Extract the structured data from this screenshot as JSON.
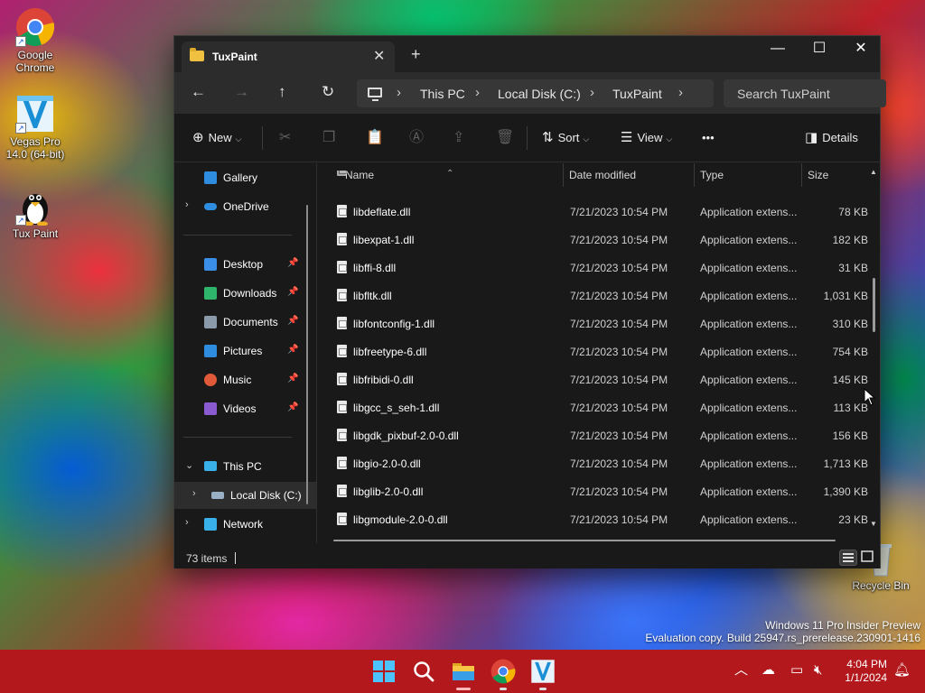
{
  "desktop": {
    "icons": [
      {
        "label": "Google Chrome"
      },
      {
        "label": "Vegas Pro 14.0 (64-bit)"
      },
      {
        "label": "Tux Paint"
      },
      {
        "label": "Recycle Bin"
      }
    ],
    "watermark": {
      "line1": "Windows 11 Pro Insider Preview",
      "line2": "Evaluation copy. Build 25947.rs_prerelease.230901-1416"
    }
  },
  "window": {
    "tab_title": "TuxPaint",
    "tab_close": "✕",
    "new_tab": "+",
    "controls": {
      "minimize": "—",
      "maximize": "☐",
      "close": "✕"
    },
    "nav": {
      "back": "←",
      "forward": "→",
      "up": "↑",
      "refresh": "↻"
    },
    "breadcrumbs": [
      "This PC",
      "Local Disk (C:)",
      "TuxPaint"
    ],
    "breadcrumb_sep": "›",
    "search_placeholder": "Search TuxPaint",
    "toolbar": {
      "new_label": "New",
      "sort_label": "Sort",
      "view_label": "View",
      "more_label": "•••",
      "details_label": "Details"
    },
    "sidebar": {
      "gallery": "Gallery",
      "onedrive": "OneDrive",
      "quick": [
        {
          "label": "Desktop",
          "color": "#3a8ee6"
        },
        {
          "label": "Downloads",
          "color": "#2fb56b"
        },
        {
          "label": "Documents",
          "color": "#8a9aaa"
        },
        {
          "label": "Pictures",
          "color": "#2f8de0"
        },
        {
          "label": "Music",
          "color": "#e05a3a"
        },
        {
          "label": "Videos",
          "color": "#8a5ad0"
        }
      ],
      "this_pc": "This PC",
      "local_disk": "Local Disk (C:)",
      "network": "Network"
    },
    "columns": {
      "name": "Name",
      "date": "Date modified",
      "type": "Type",
      "size": "Size"
    },
    "files": [
      {
        "name": "libdeflate.dll",
        "date": "7/21/2023 10:54 PM",
        "type": "Application extens...",
        "size": "78 KB"
      },
      {
        "name": "libexpat-1.dll",
        "date": "7/21/2023 10:54 PM",
        "type": "Application extens...",
        "size": "182 KB"
      },
      {
        "name": "libffi-8.dll",
        "date": "7/21/2023 10:54 PM",
        "type": "Application extens...",
        "size": "31 KB"
      },
      {
        "name": "libfltk.dll",
        "date": "7/21/2023 10:54 PM",
        "type": "Application extens...",
        "size": "1,031 KB"
      },
      {
        "name": "libfontconfig-1.dll",
        "date": "7/21/2023 10:54 PM",
        "type": "Application extens...",
        "size": "310 KB"
      },
      {
        "name": "libfreetype-6.dll",
        "date": "7/21/2023 10:54 PM",
        "type": "Application extens...",
        "size": "754 KB"
      },
      {
        "name": "libfribidi-0.dll",
        "date": "7/21/2023 10:54 PM",
        "type": "Application extens...",
        "size": "145 KB"
      },
      {
        "name": "libgcc_s_seh-1.dll",
        "date": "7/21/2023 10:54 PM",
        "type": "Application extens...",
        "size": "113 KB"
      },
      {
        "name": "libgdk_pixbuf-2.0-0.dll",
        "date": "7/21/2023 10:54 PM",
        "type": "Application extens...",
        "size": "156 KB"
      },
      {
        "name": "libgio-2.0-0.dll",
        "date": "7/21/2023 10:54 PM",
        "type": "Application extens...",
        "size": "1,713 KB"
      },
      {
        "name": "libglib-2.0-0.dll",
        "date": "7/21/2023 10:54 PM",
        "type": "Application extens...",
        "size": "1,390 KB"
      },
      {
        "name": "libgmodule-2.0-0.dll",
        "date": "7/21/2023 10:54 PM",
        "type": "Application extens...",
        "size": "23 KB"
      }
    ],
    "status": "73 items"
  },
  "taskbar": {
    "time": "4:04 PM",
    "date": "1/1/2024",
    "color": "#b3181c"
  }
}
